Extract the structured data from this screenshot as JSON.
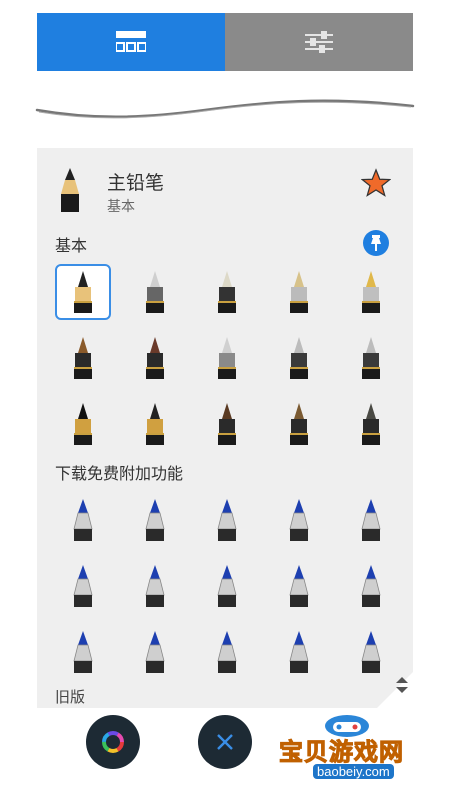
{
  "tabs": [
    {
      "name": "brush-library-icon",
      "active": true
    },
    {
      "name": "brush-settings-icon",
      "active": false
    }
  ],
  "current_brush": {
    "name": "主铅笔",
    "category": "基本",
    "favorite_icon": "star-icon",
    "accent_color": "#f06a2a"
  },
  "sections": {
    "basic": "基本",
    "download": "下载免费附加功能",
    "legacy_partial": "旧版"
  },
  "basic_brushes": [
    {
      "icon": "pencil-icon",
      "tip": "#222222",
      "body": "#e8c27a",
      "selected": true
    },
    {
      "icon": "eraser-icon",
      "tip": "#cfcfcf",
      "body": "#666666"
    },
    {
      "icon": "ballpoint-icon",
      "tip": "#ddd9c8",
      "body": "#333333"
    },
    {
      "icon": "fineliner-icon",
      "tip": "#d7c28a",
      "body": "#bbbbbb"
    },
    {
      "icon": "fountain-pen-icon",
      "tip": "#e0b84a",
      "body": "#bfbfbf"
    },
    {
      "icon": "paintbrush-icon",
      "tip": "#8a5a2a",
      "body": "#2a2a2a"
    },
    {
      "icon": "ink-brush-icon",
      "tip": "#6a3a2a",
      "body": "#2a2a2a"
    },
    {
      "icon": "airbrush-icon",
      "tip": "#d0d0d0",
      "body": "#8a8a8a"
    },
    {
      "icon": "smudge-icon",
      "tip": "#bcbcbc",
      "body": "#3a3a3a"
    },
    {
      "icon": "blur-icon",
      "tip": "#bcbcbc",
      "body": "#3a3a3a"
    },
    {
      "icon": "flat-brush-icon",
      "tip": "#111111",
      "body": "#d0a040"
    },
    {
      "icon": "texture-brush-icon",
      "tip": "#222222",
      "body": "#d0a040"
    },
    {
      "icon": "bristle-brush-icon",
      "tip": "#5a3a22",
      "body": "#2a2a2a"
    },
    {
      "icon": "fan-brush-icon",
      "tip": "#7a5a32",
      "body": "#2a2a2a"
    },
    {
      "icon": "hair-brush-icon",
      "tip": "#4a4a44",
      "body": "#2a2a2a"
    }
  ],
  "download_brushes": [
    {
      "icon": "marker-fine-icon",
      "tip": "#1d3fb0",
      "body": "#cfcfcf"
    },
    {
      "icon": "marker-fine-icon",
      "tip": "#1d3fb0",
      "body": "#cfcfcf"
    },
    {
      "icon": "marker-fine-icon",
      "tip": "#1d3fb0",
      "body": "#cfcfcf"
    },
    {
      "icon": "technical-pen-icon",
      "tip": "#1d3fb0",
      "body": "#cfcfcf"
    },
    {
      "icon": "technical-pen-icon",
      "tip": "#1d3fb0",
      "body": "#cfcfcf"
    },
    {
      "icon": "marker-bullet-icon",
      "tip": "#1d3fb0",
      "body": "#cfcfcf"
    },
    {
      "icon": "marker-bullet-icon",
      "tip": "#1d3fb0",
      "body": "#cfcfcf"
    },
    {
      "icon": "marker-bullet-icon",
      "tip": "#1d3fb0",
      "body": "#cfcfcf"
    },
    {
      "icon": "marker-bullet-icon",
      "tip": "#1d3fb0",
      "body": "#cfcfcf"
    },
    {
      "icon": "marker-bullet-icon",
      "tip": "#1d3fb0",
      "body": "#cfcfcf"
    },
    {
      "icon": "marker-chisel-icon",
      "tip": "#1d3fb0",
      "body": "#cfcfcf"
    },
    {
      "icon": "marker-chisel-icon",
      "tip": "#1d3fb0",
      "body": "#cfcfcf"
    },
    {
      "icon": "marker-chisel-icon",
      "tip": "#1d3fb0",
      "body": "#cfcfcf"
    },
    {
      "icon": "marker-wide-icon",
      "tip": "#1d3fb0",
      "body": "#cfcfcf"
    },
    {
      "icon": "marker-wide-icon",
      "tip": "#1d3fb0",
      "body": "#cfcfcf"
    }
  ],
  "bottom_bar": {
    "color_button_icon": "color-wheel-icon",
    "close_button_icon": "close-icon"
  },
  "watermark": {
    "text": "宝贝游戏网",
    "url": "baobeiy.com"
  },
  "colors": {
    "accent": "#1f7fe0",
    "inactive_tab": "#8a8a8a",
    "panel": "#efefef",
    "button": "#1d2a34"
  }
}
